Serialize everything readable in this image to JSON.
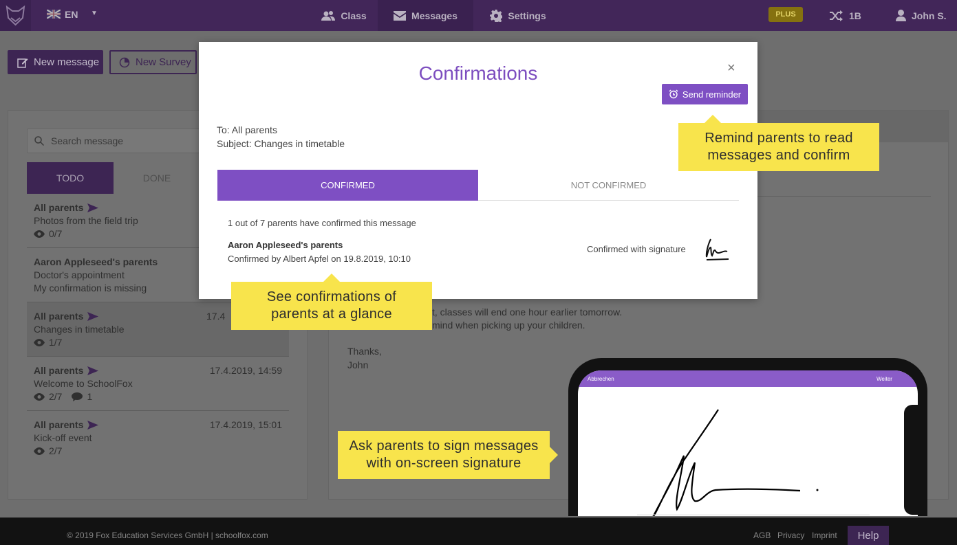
{
  "topbar": {
    "language": "EN",
    "nav": {
      "class": "Class",
      "messages": "Messages",
      "settings": "Settings"
    },
    "plus_badge": "PLUS",
    "class_switcher": "1B",
    "user": "John S."
  },
  "actions": {
    "new_message": "New message",
    "new_survey": "New Survey"
  },
  "sidebar": {
    "search_placeholder": "Search message",
    "tabs": {
      "todo": "TODO",
      "done": "DONE"
    },
    "messages": [
      {
        "recipient": "All parents",
        "subject": "Photos from the field trip",
        "views": "0/7"
      },
      {
        "recipient": "Aaron Appleseed's parents",
        "subject": "Doctor's appointment",
        "status": "My confirmation is missing"
      },
      {
        "recipient": "All parents",
        "date": "17.4",
        "subject": "Changes in timetable",
        "views": "1/7"
      },
      {
        "recipient": "All parents",
        "date": "17.4.2019, 14:59",
        "subject": "Welcome to SchoolFox",
        "views": "2/7",
        "comments": "1"
      },
      {
        "recipient": "All parents",
        "date": "17.4.2019, 15:01",
        "subject": "Kick-off event",
        "views": "2/7"
      }
    ]
  },
  "message_body": {
    "line1": "t, classes will end one hour earlier tomorrow.",
    "line2": "mind when picking up your children.",
    "thanks": "Thanks,",
    "signoff": "John"
  },
  "modal": {
    "title": "Confirmations",
    "close": "×",
    "send_reminder": "Send reminder",
    "to": "To: All parents",
    "subject": "Subject: Changes in timetable",
    "tabs": {
      "confirmed": "CONFIRMED",
      "not_confirmed": "NOT CONFIRMED"
    },
    "summary": "1 out of 7 parents have confirmed this message",
    "entry": {
      "name": "Aaron Appleseed's parents",
      "detail": "Confirmed by Albert Apfel on 19.8.2019, 10:10",
      "method": "Confirmed with signature"
    }
  },
  "callouts": {
    "reminder_line1": "Remind parents to read",
    "reminder_line2": "messages and confirm",
    "glance_line1": "See confirmations of",
    "glance_line2": "parents at a glance",
    "sign_line1": "Ask parents to sign messages",
    "sign_line2": "with on-screen signature"
  },
  "phone": {
    "cancel": "Abbrechen",
    "next": "Weiter"
  },
  "footer": {
    "copyright": "© 2019 Fox Education Services GmbH | schoolfox.com",
    "agb": "AGB",
    "privacy": "Privacy",
    "imprint": "Imprint",
    "help": "Help"
  },
  "colors": {
    "brand_purple": "#7e4fc3",
    "dark_purple": "#422659",
    "callout_yellow": "#f8e44c"
  }
}
